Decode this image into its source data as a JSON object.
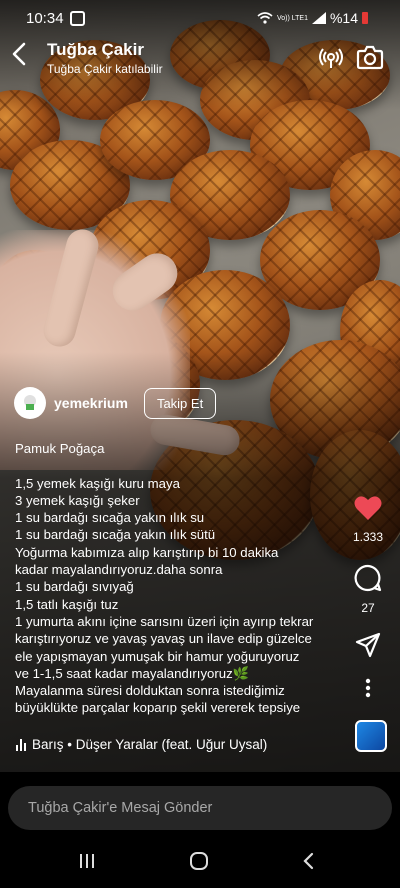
{
  "status_bar": {
    "time": "10:34",
    "lte": "Vo)) LTE1",
    "battery": "%14"
  },
  "header": {
    "name": "Tuğba Çakir",
    "subtitle": "Tuğba Çakir katılabilir"
  },
  "post": {
    "username": "yemekrium",
    "follow_label": "Takip Et",
    "caption_title": "Pamuk Poğaça",
    "caption_lines": [
      "1,5 yemek kaşığı kuru maya",
      "3 yemek kaşığı şeker",
      "1 su bardağı sıcağa yakın ılık su",
      "1 su bardağı sıcağa yakın ılık sütü",
      "Yoğurma kabımıza alıp karıştırıp bi 10 dakika",
      "kadar mayalandırıyoruz.daha sonra",
      "1 su bardağı sıvıyağ",
      "1,5 tatlı kaşığı tuz",
      "1 yumurta akını içine sarısını üzeri için ayırıp tekrar",
      "karıştırıyoruz ve yavaş yavaş un ilave edip güzelce",
      "ele yapışmayan yumuşak bir hamur yoğuruyoruz",
      "ve 1-1,5 saat kadar mayalandırıyoruz🌿",
      "Mayalanma süresi dolduktan sonra istediğimiz",
      "büyüklükte parçalar koparıp şekil vererek tepsiye"
    ],
    "music": "Barış • Düşer Yaralar (feat. Uğur Uysal)",
    "likes": "1.333",
    "comments": "27"
  },
  "message_placeholder": "Tuğba Çakir'e Mesaj Gönder",
  "colors": {
    "like": "#ed4956",
    "input_bg": "#262626"
  }
}
